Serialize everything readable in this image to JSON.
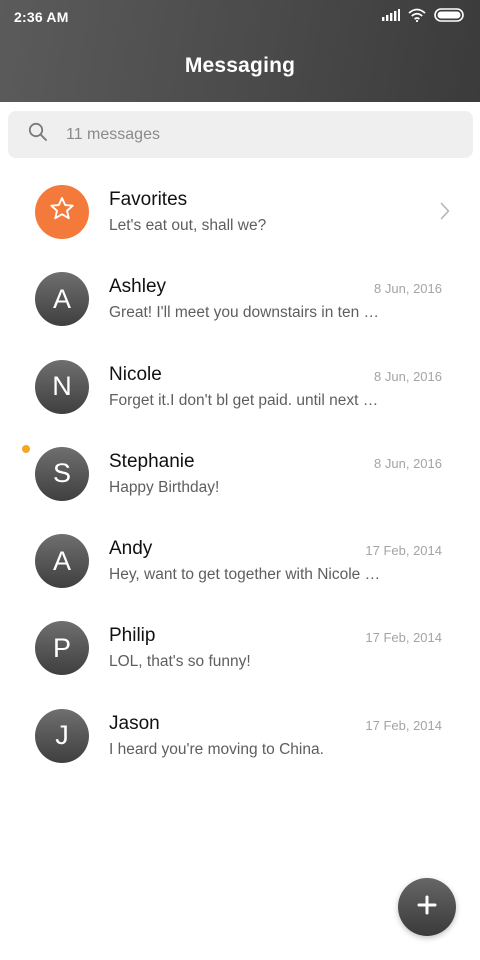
{
  "status_bar": {
    "time": "2:36 AM"
  },
  "header": {
    "title": "Messaging"
  },
  "search": {
    "placeholder": "11 messages"
  },
  "favorites": {
    "name": "Favorites",
    "preview": "Let's eat out, shall we?"
  },
  "conversations": [
    {
      "initial": "A",
      "name": "Ashley",
      "date": "8 Jun, 2016",
      "preview": "Great! I'll meet you downstairs in ten …",
      "unread": false
    },
    {
      "initial": "N",
      "name": "Nicole",
      "date": "8 Jun, 2016",
      "preview": "Forget it.I don't bl get paid. until next …",
      "unread": false
    },
    {
      "initial": "S",
      "name": "Stephanie",
      "date": "8 Jun, 2016",
      "preview": "Happy Birthday!",
      "unread": true
    },
    {
      "initial": "A",
      "name": "Andy",
      "date": "17 Feb, 2014",
      "preview": "Hey, want to get together with Nicole …",
      "unread": false
    },
    {
      "initial": "P",
      "name": "Philip",
      "date": "17 Feb, 2014",
      "preview": "LOL, that's so funny!",
      "unread": false
    },
    {
      "initial": "J",
      "name": "Jason",
      "date": "17 Feb, 2014",
      "preview": "I heard you're moving to China.",
      "unread": false
    }
  ],
  "colors": {
    "favorites_accent": "#f47a3b",
    "unread_dot": "#f5a623",
    "header_background": "#4a4a4a"
  },
  "icons": {
    "signal": "signal-icon",
    "wifi": "wifi-icon",
    "battery": "battery-icon",
    "search": "search-icon",
    "favorites": "star-icon",
    "chevron": "chevron-right-icon",
    "compose": "plus-icon"
  }
}
